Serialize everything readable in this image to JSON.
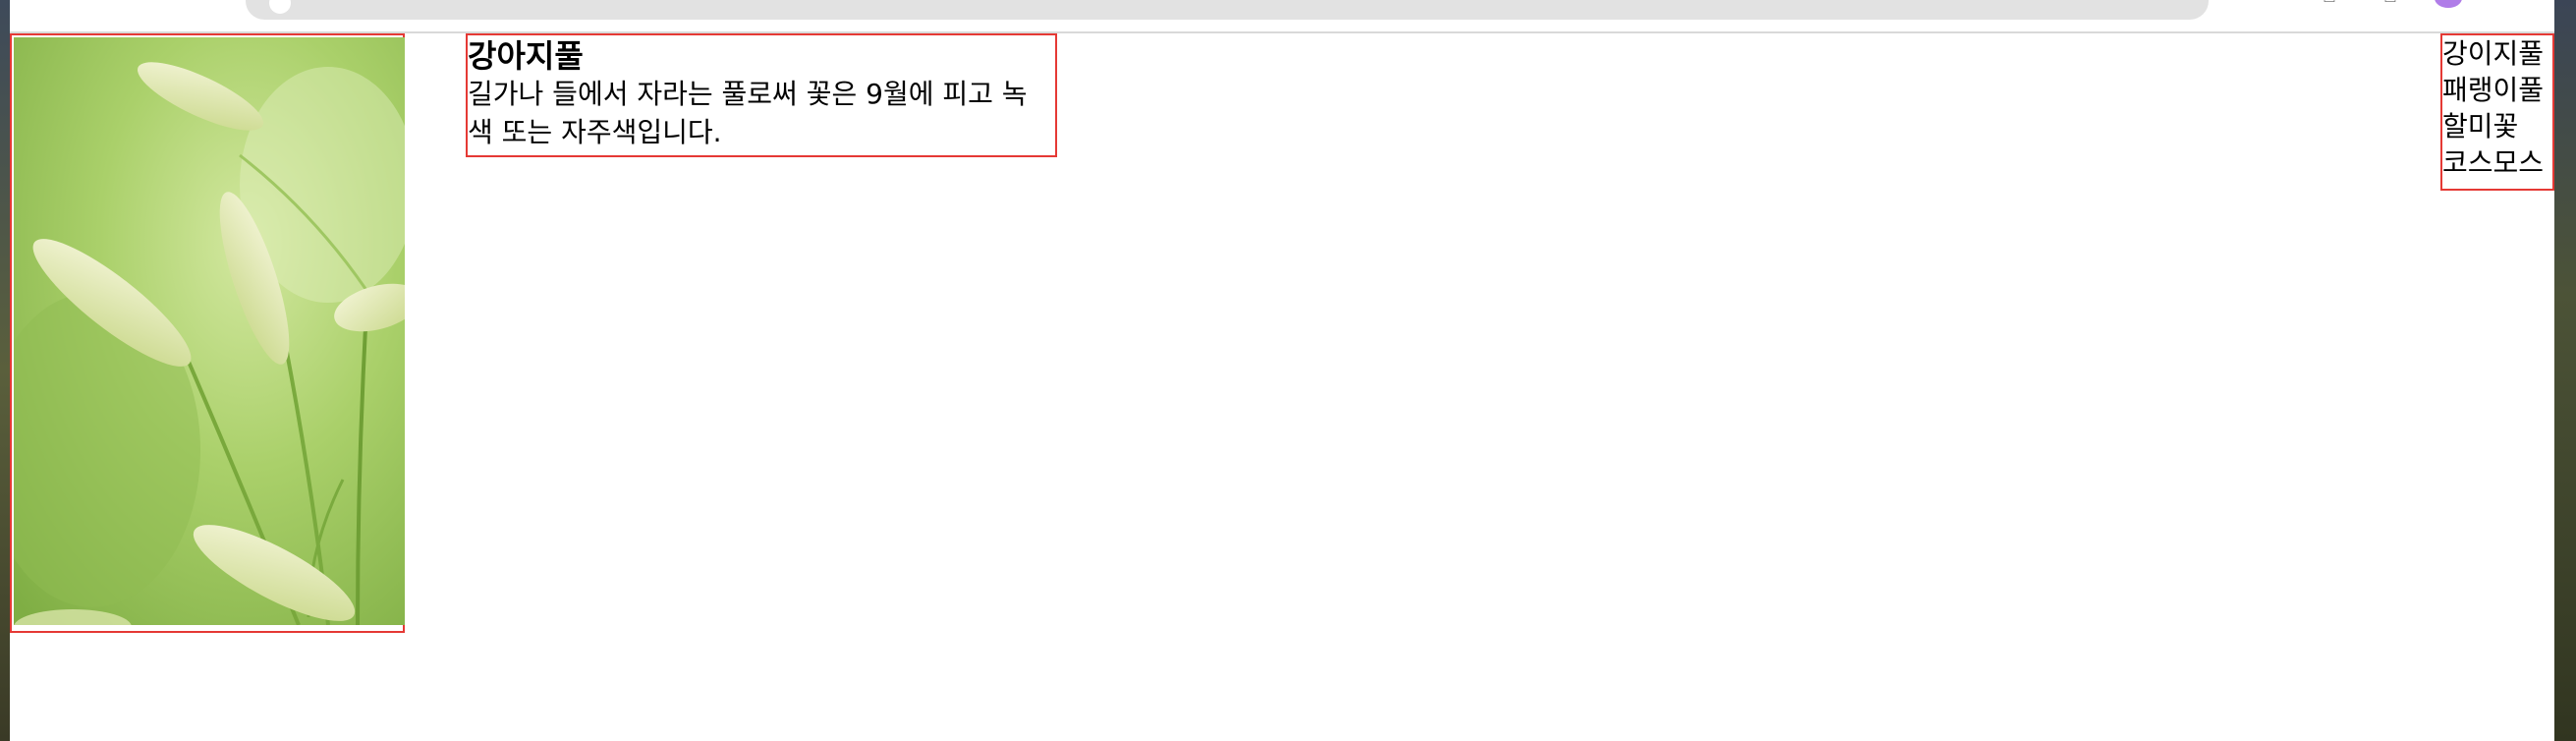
{
  "article": {
    "title": "강아지풀",
    "description": "길가나 들에서 자라는 풀로써 꽃은 9월에 피고 녹색 또는 자주색입니다."
  },
  "sidebar": {
    "items": [
      {
        "label": "강이지풀"
      },
      {
        "label": "패랭이풀"
      },
      {
        "label": "할미꽃"
      },
      {
        "label": "코스모스"
      }
    ]
  },
  "image": {
    "subject": "foxtail-grass-photo"
  },
  "colors": {
    "outline": "#e53935",
    "photo_bg": "#a6cf64",
    "stem": "#6c9e34",
    "seedhead": "#e6ecc0"
  }
}
